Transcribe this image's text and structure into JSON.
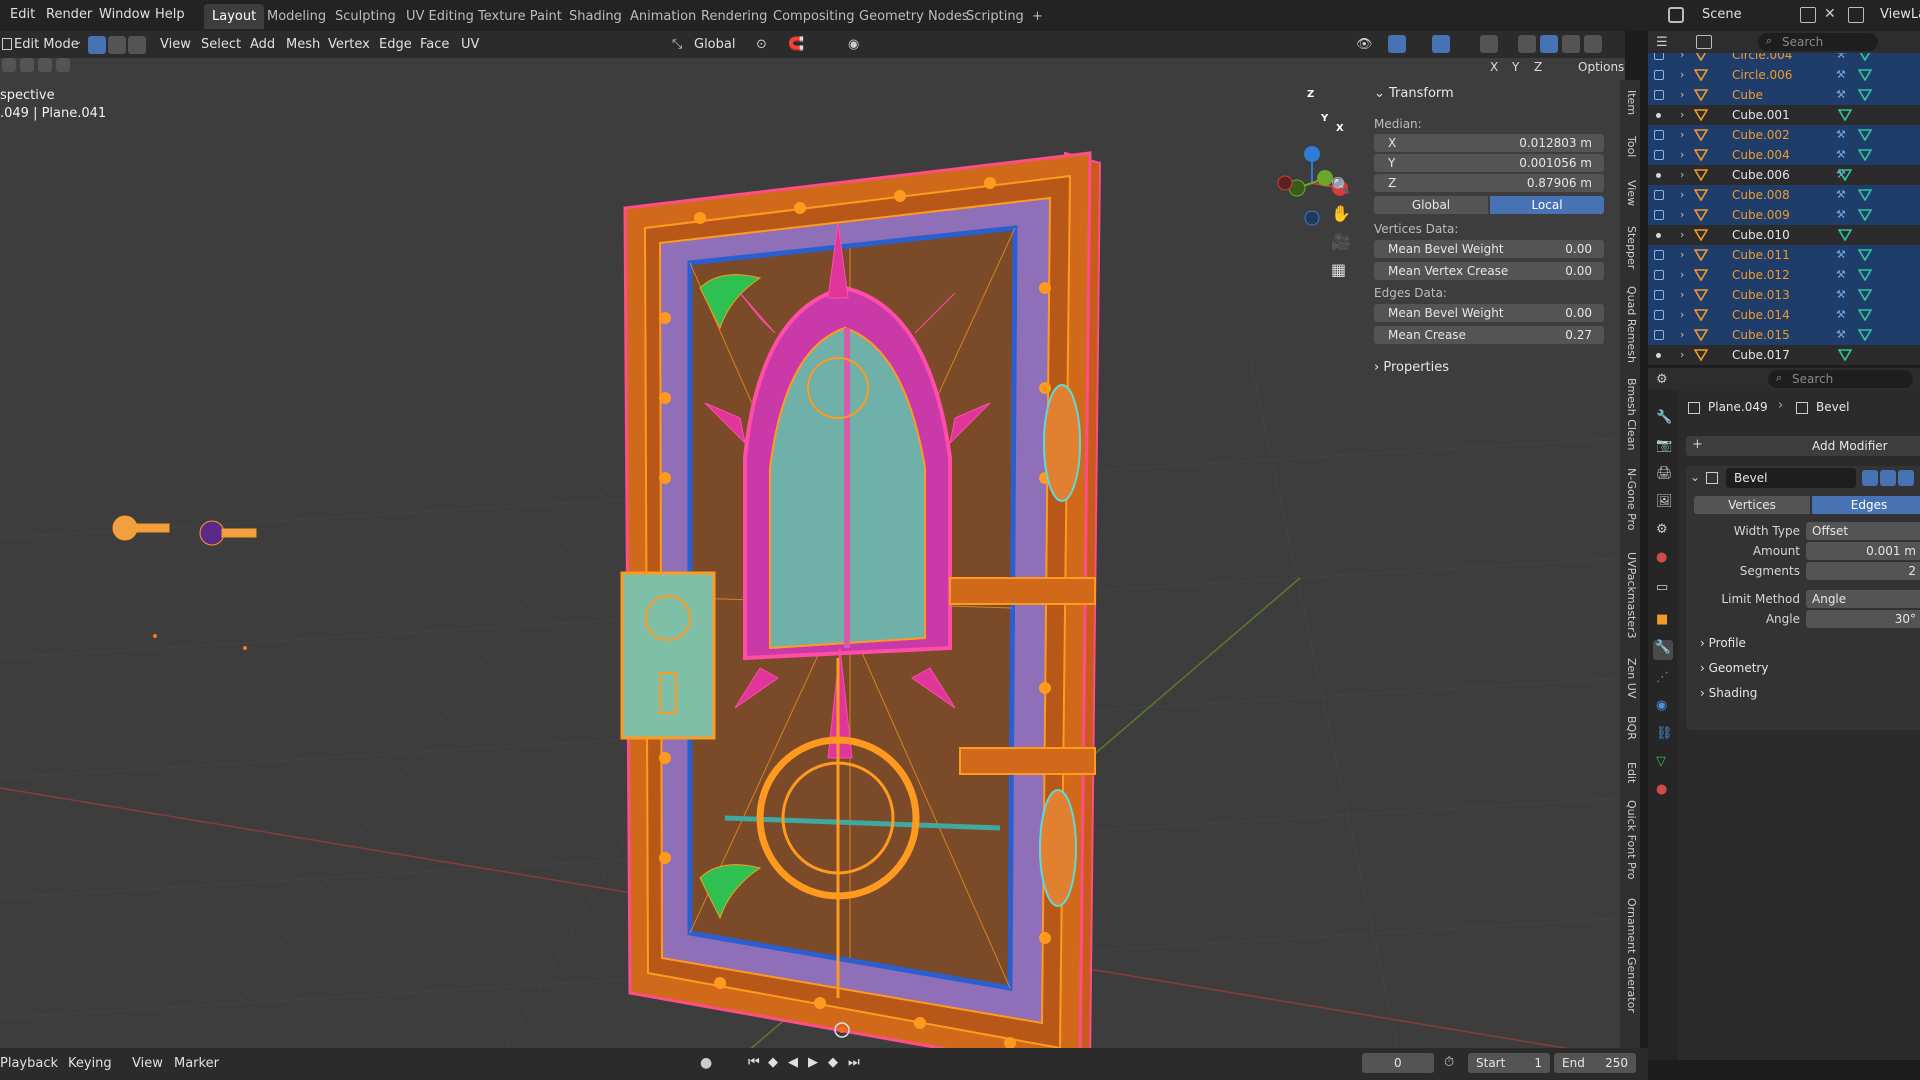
{
  "menubar": {
    "items": [
      "Edit",
      "Render",
      "Window",
      "Help"
    ],
    "workspaces": [
      "Layout",
      "Modeling",
      "Sculpting",
      "UV Editing",
      "Texture Paint",
      "Shading",
      "Animation",
      "Rendering",
      "Compositing",
      "Geometry Nodes",
      "Scripting"
    ],
    "active_workspace": "Layout",
    "add_tab": "+",
    "scene_label": "Scene",
    "viewlayer_label": "ViewLay"
  },
  "viewport_header": {
    "mode": "Edit Mode",
    "menus": [
      "View",
      "Select",
      "Add",
      "Mesh",
      "Vertex",
      "Edge",
      "Face",
      "UV"
    ],
    "orientation": "Global",
    "axes": [
      "X",
      "Y",
      "Z"
    ],
    "options": "Options"
  },
  "viewport": {
    "view_label": "spective",
    "object_label": ".049 | Plane.041",
    "gizmo_axes": [
      "Z",
      "Y",
      "X"
    ]
  },
  "npanel": {
    "transform_title": "Transform",
    "median_label": "Median:",
    "fields": [
      {
        "label": "X",
        "value": "0.012803 m"
      },
      {
        "label": "Y",
        "value": "0.001056 m"
      },
      {
        "label": "Z",
        "value": "0.87906 m"
      }
    ],
    "global_label": "Global",
    "local_label": "Local",
    "vertices_data_label": "Vertices Data:",
    "vertex_fields": [
      {
        "label": "Mean Bevel Weight",
        "value": "0.00"
      },
      {
        "label": "Mean Vertex Crease",
        "value": "0.00"
      }
    ],
    "edges_data_label": "Edges Data:",
    "edge_fields": [
      {
        "label": "Mean Bevel Weight",
        "value": "0.00"
      },
      {
        "label": "Mean Crease",
        "value": "0.27"
      }
    ],
    "properties_title": "Properties"
  },
  "side_tabs": [
    "Item",
    "Tool",
    "View",
    "Stepper",
    "Quad Remesh",
    "Bmesh Clean",
    "N-Gone Pro",
    "UVPackmaster3",
    "Zen UV",
    "BQR",
    "Edit",
    "Quick Font Pro",
    "Ornament Generator"
  ],
  "outliner": {
    "search_placeholder": "Search",
    "rows": [
      {
        "name": "Circle.004",
        "orange": true,
        "selected": true
      },
      {
        "name": "Circle.006",
        "orange": true,
        "selected": true
      },
      {
        "name": "Cube",
        "orange": true,
        "selected": true
      },
      {
        "name": "Cube.001",
        "orange": false,
        "selected": false
      },
      {
        "name": "Cube.002",
        "orange": true,
        "selected": true
      },
      {
        "name": "Cube.004",
        "orange": true,
        "selected": true
      },
      {
        "name": "Cube.006",
        "orange": false,
        "selected": false
      },
      {
        "name": "Cube.008",
        "orange": true,
        "selected": true
      },
      {
        "name": "Cube.009",
        "orange": true,
        "selected": true
      },
      {
        "name": "Cube.010",
        "orange": false,
        "selected": false
      },
      {
        "name": "Cube.011",
        "orange": true,
        "selected": true
      },
      {
        "name": "Cube.012",
        "orange": true,
        "selected": true
      },
      {
        "name": "Cube.013",
        "orange": true,
        "selected": true
      },
      {
        "name": "Cube.014",
        "orange": true,
        "selected": true
      },
      {
        "name": "Cube.015",
        "orange": true,
        "selected": true
      },
      {
        "name": "Cube.017",
        "orange": false,
        "selected": false
      }
    ]
  },
  "properties": {
    "search_placeholder": "Search",
    "breadcrumb_object": "Plane.049",
    "breadcrumb_modifier": "Bevel",
    "add_modifier": "Add Modifier",
    "modifier_name": "Bevel",
    "mode_vertices": "Vertices",
    "mode_edges": "Edges",
    "width_type_label": "Width Type",
    "width_type_value": "Offset",
    "amount_label": "Amount",
    "amount_value": "0.001 m",
    "segments_label": "Segments",
    "segments_value": "2",
    "limit_method_label": "Limit Method",
    "limit_method_value": "Angle",
    "angle_label": "Angle",
    "angle_value": "30°",
    "subpanels": [
      "Profile",
      "Geometry",
      "Shading"
    ]
  },
  "timeline": {
    "menus": [
      "Playback",
      "Keying",
      "View",
      "Marker"
    ],
    "current_frame": "0",
    "start_label": "Start",
    "start_value": "1",
    "end_label": "End",
    "end_value": "250"
  },
  "colors": {
    "accent": "#4772b3",
    "selected_orange": "#f09a2a",
    "wire_orange": "#ff9a1f",
    "pink": "#e0359a",
    "cyan": "#5fd8d8"
  }
}
